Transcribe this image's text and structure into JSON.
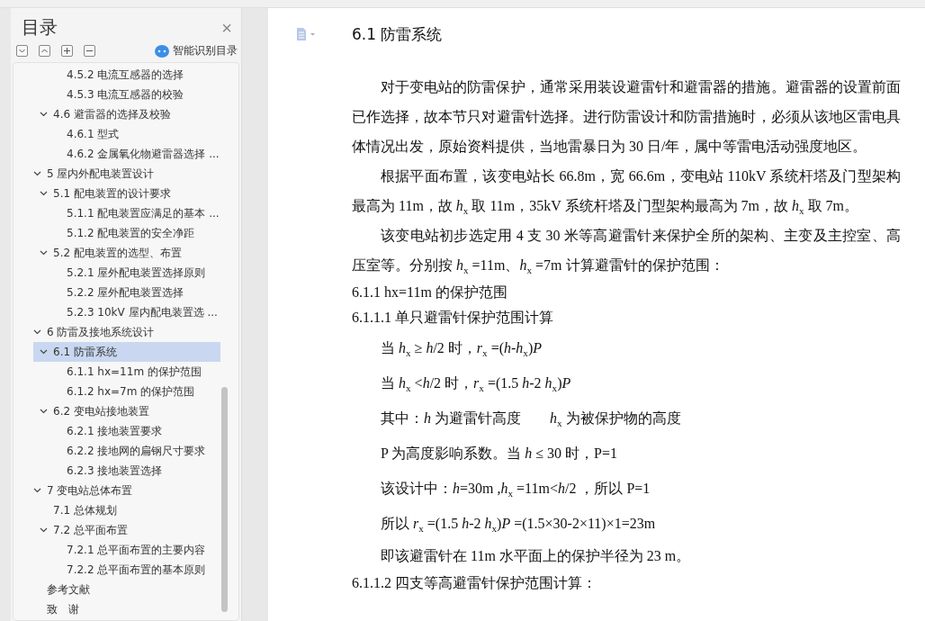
{
  "toc_panel": {
    "title": "目录",
    "close": "×",
    "smart_toc": "智能识别目录",
    "items": [
      {
        "children": [
          {
            "children": [
              {
                "label": "4.5.2  电流互感器的选择",
                "selected": false
              },
              {
                "label": "4.5.3  电流互感器的校验",
                "selected": false
              }
            ]
          },
          {
            "label": "4.6  避雷器的选择及校验",
            "selected": false,
            "expanded": true,
            "children": [
              {
                "label": "4.6.1  型式",
                "selected": false
              },
              {
                "label": "4.6.2  金属氧化物避雷器选择 ...",
                "selected": false
              }
            ]
          }
        ]
      },
      {
        "label": "5  屋内外配电装置设计",
        "selected": false,
        "expanded": true,
        "children": [
          {
            "label": "5.1  配电装置的设计要求",
            "selected": false,
            "expanded": true,
            "children": [
              {
                "label": "5.1.1  配电装置应满足的基本 ...",
                "selected": false
              },
              {
                "label": "5.1.2  配电装置的安全净距",
                "selected": false
              }
            ]
          },
          {
            "label": "5.2  配电装置的选型、布置",
            "selected": false,
            "expanded": true,
            "children": [
              {
                "label": "5.2.1  屋外配电装置选择原则",
                "selected": false
              },
              {
                "label": "5.2.2  屋外配电装置选择",
                "selected": false
              },
              {
                "label": "5.2.3 10kV 屋内配电装置选 ...",
                "selected": false
              }
            ]
          }
        ]
      },
      {
        "label": "6  防雷及接地系统设计",
        "selected": false,
        "expanded": true,
        "children": [
          {
            "label": "6.1  防雷系统",
            "selected": true,
            "expanded": true,
            "children": [
              {
                "label": "6.1.1 hx=11m 的保护范围",
                "selected": false
              },
              {
                "label": "6.1.2 hx=7m 的保护范围",
                "selected": false
              }
            ]
          },
          {
            "label": "6.2  变电站接地装置",
            "selected": false,
            "expanded": true,
            "children": [
              {
                "label": "6.2.1  接地装置要求",
                "selected": false
              },
              {
                "label": "6.2.2  接地网的扁钢尺寸要求",
                "selected": false
              },
              {
                "label": "6.2.3  接地装置选择",
                "selected": false
              }
            ]
          }
        ]
      },
      {
        "label": "7  变电站总体布置",
        "selected": false,
        "expanded": true,
        "children": [
          {
            "label": "7.1  总体规划",
            "selected": false
          },
          {
            "label": "7.2  总平面布置",
            "selected": false,
            "expanded": true,
            "children": [
              {
                "label": "7.2.1  总平面布置的主要内容",
                "selected": false
              },
              {
                "label": "7.2.2  总平面布置的基本原则",
                "selected": false
              }
            ]
          }
        ]
      },
      {
        "label": "参考文献",
        "selected": false
      },
      {
        "label": "致　谢",
        "selected": false
      }
    ]
  },
  "document": {
    "title": "6.1  防雷系统",
    "blocks": [
      {
        "kind": "paragraph",
        "text": "对于变电站的防雷保护，通常采用装设避雷针和避雷器的措施。避雷器的设置前面已作选择，故本节只对避雷针选择。进行防雷设计和防雷措施时，必须从该地区雷电具体情况出发，原始资料提供，当地雷暴日为 30 日/年，属中等雷电活动强度地区。"
      },
      {
        "kind": "paragraph",
        "text": "根据平面布置，该变电站长 66.8m，宽 66.6m，变电站 110kV 系统杆塔及门型架构最高为 11m，故 *h*$_{x}$ 取 11m，35kV 系统杆塔及门型架构最高为 7m，故 *h*$_{x}$ 取 7m。"
      },
      {
        "kind": "paragraph",
        "text": "该变电站初步选定用 4 支 30 米等高避雷针来保护全所的架构、主变及主控室、高压室等。分别按 *h*$_{x}$ =11m、*h*$_{x}$ =7m 计算避雷针的保护范围："
      },
      {
        "kind": "heading",
        "text": "6.1.1 hx=11m 的保护范围"
      },
      {
        "kind": "heading",
        "text": "6.1.1.1  单只避雷针保护范围计算"
      },
      {
        "kind": "formula",
        "text": "当 *h*$_{x}$ ≥ *h*/2 时，*r*$_{x}$ =(*h*-*h*$_{x}$)*P*"
      },
      {
        "kind": "formula",
        "text": "当 *h*$_{x}$ <*h*/2 时，*r*$_{x}$ =(1.5 *h*-2 *h*$_{x}$)*P*"
      },
      {
        "kind": "formula",
        "text": "其中：*h* 为避雷针高度　　*h*$_{x}$ 为被保护物的高度"
      },
      {
        "kind": "formula",
        "text": "P 为高度影响系数。当 *h* ≤ 30 时，P=1"
      },
      {
        "kind": "formula",
        "text": "该设计中：*h*=30m ,*h*$_{x}$ =11m<*h*/2 ，所以 P=1"
      },
      {
        "kind": "formula",
        "text": "所以 *r*$_{x}$ =(1.5 *h*-2 *h*$_{x}$)*P* =(1.5×30-2×11)×1=23m"
      },
      {
        "kind": "paragraph",
        "text": "即该避雷针在 11m 水平面上的保护半径为 23 m。"
      },
      {
        "kind": "heading",
        "text": "6.1.1.2  四支等高避雷针保护范围计算："
      }
    ]
  }
}
